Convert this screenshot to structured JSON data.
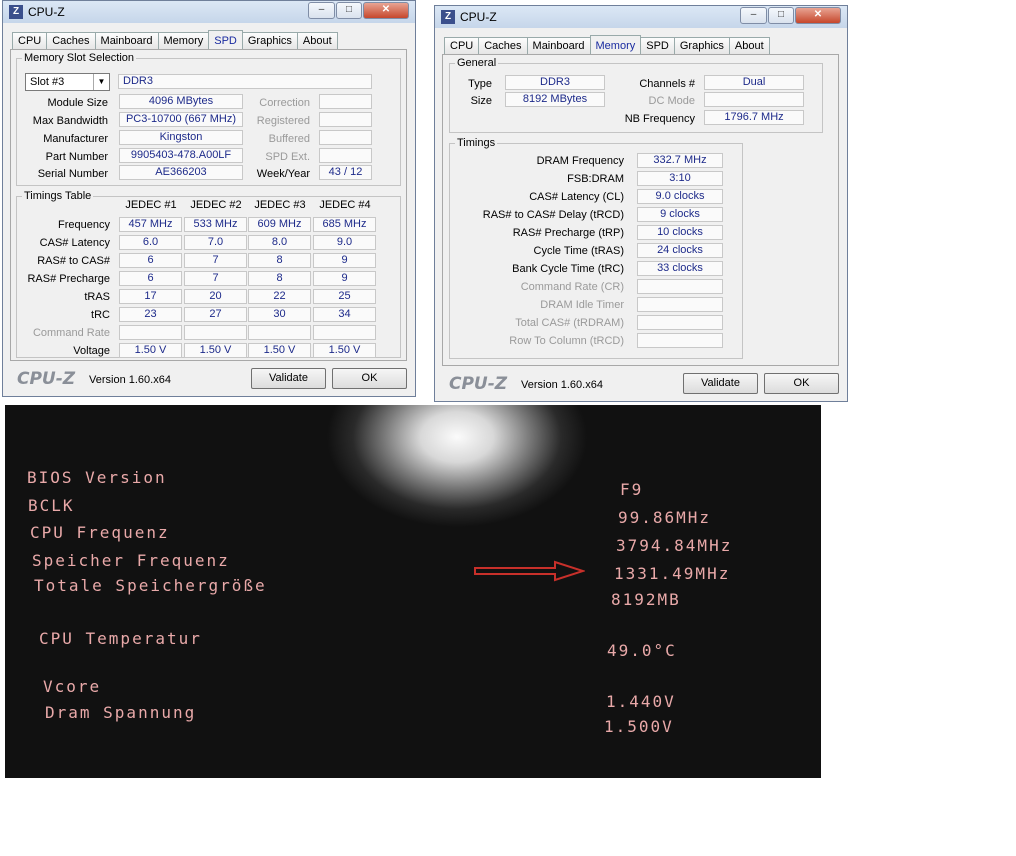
{
  "window1": {
    "title": "CPU-Z",
    "tabs": [
      "CPU",
      "Caches",
      "Mainboard",
      "Memory",
      "SPD",
      "Graphics",
      "About"
    ],
    "active_tab": "SPD",
    "slot_group_label": "Memory Slot Selection",
    "slot_selected": "Slot #3",
    "memory_type": "DDR3",
    "module_size_label": "Module Size",
    "module_size": "4096 MBytes",
    "max_bandwidth_label": "Max Bandwidth",
    "max_bandwidth": "PC3-10700 (667 MHz)",
    "manufacturer_label": "Manufacturer",
    "manufacturer": "Kingston",
    "part_number_label": "Part Number",
    "part_number": "9905403-478.A00LF",
    "serial_number_label": "Serial Number",
    "serial_number": "AE366203",
    "correction_label": "Correction",
    "registered_label": "Registered",
    "buffered_label": "Buffered",
    "spd_ext_label": "SPD Ext.",
    "week_year_label": "Week/Year",
    "week_year": "43 / 12",
    "timings_group_label": "Timings Table",
    "timings_columns": [
      "JEDEC #1",
      "JEDEC #2",
      "JEDEC #3",
      "JEDEC #4"
    ],
    "timings_rows": [
      {
        "label": "Frequency",
        "values": [
          "457 MHz",
          "533 MHz",
          "609 MHz",
          "685 MHz"
        ]
      },
      {
        "label": "CAS# Latency",
        "values": [
          "6.0",
          "7.0",
          "8.0",
          "9.0"
        ]
      },
      {
        "label": "RAS# to CAS#",
        "values": [
          "6",
          "7",
          "8",
          "9"
        ]
      },
      {
        "label": "RAS# Precharge",
        "values": [
          "6",
          "7",
          "8",
          "9"
        ]
      },
      {
        "label": "tRAS",
        "values": [
          "17",
          "20",
          "22",
          "25"
        ]
      },
      {
        "label": "tRC",
        "values": [
          "23",
          "27",
          "30",
          "34"
        ]
      },
      {
        "label": "Command Rate",
        "values": [
          "",
          "",
          "",
          ""
        ]
      },
      {
        "label": "Voltage",
        "values": [
          "1.50 V",
          "1.50 V",
          "1.50 V",
          "1.50 V"
        ]
      }
    ],
    "logo": "CPU-Z",
    "version": "Version 1.60.x64",
    "validate_label": "Validate",
    "ok_label": "OK"
  },
  "window2": {
    "title": "CPU-Z",
    "tabs": [
      "CPU",
      "Caches",
      "Mainboard",
      "Memory",
      "SPD",
      "Graphics",
      "About"
    ],
    "active_tab": "Memory",
    "general_group_label": "General",
    "type_label": "Type",
    "type": "DDR3",
    "size_label": "Size",
    "size": "8192 MBytes",
    "channels_label": "Channels #",
    "channels": "Dual",
    "dc_mode_label": "DC Mode",
    "nb_freq_label": "NB Frequency",
    "nb_freq": "1796.7 MHz",
    "timings_group_label": "Timings",
    "timings": [
      {
        "label": "DRAM Frequency",
        "value": "332.7 MHz"
      },
      {
        "label": "FSB:DRAM",
        "value": "3:10"
      },
      {
        "label": "CAS# Latency (CL)",
        "value": "9.0 clocks"
      },
      {
        "label": "RAS# to CAS# Delay (tRCD)",
        "value": "9 clocks"
      },
      {
        "label": "RAS# Precharge (tRP)",
        "value": "10 clocks"
      },
      {
        "label": "Cycle Time (tRAS)",
        "value": "24 clocks"
      },
      {
        "label": "Bank Cycle Time (tRC)",
        "value": "33 clocks"
      },
      {
        "label": "Command Rate (CR)",
        "value": ""
      },
      {
        "label": "DRAM Idle Timer",
        "value": ""
      },
      {
        "label": "Total CAS# (tRDRAM)",
        "value": ""
      },
      {
        "label": "Row To Column (tRCD)",
        "value": ""
      }
    ],
    "logo": "CPU-Z",
    "version": "Version 1.60.x64",
    "validate_label": "Validate",
    "ok_label": "OK"
  },
  "bios": {
    "rows": [
      {
        "label": "BIOS Version",
        "value": "F9"
      },
      {
        "label": "BCLK",
        "value": "99.86MHz"
      },
      {
        "label": "CPU Frequenz",
        "value": "3794.84MHz"
      },
      {
        "label": "Speicher Frequenz",
        "value": "1331.49MHz"
      },
      {
        "label": "Totale Speichergröße",
        "value": "8192MB"
      },
      {
        "label": "CPU Temperatur",
        "value": "49.0°C"
      },
      {
        "label": "Vcore",
        "value": "1.440V"
      },
      {
        "label": "Dram Spannung",
        "value": "1.500V"
      }
    ],
    "arrow_color": "#c8302a"
  }
}
